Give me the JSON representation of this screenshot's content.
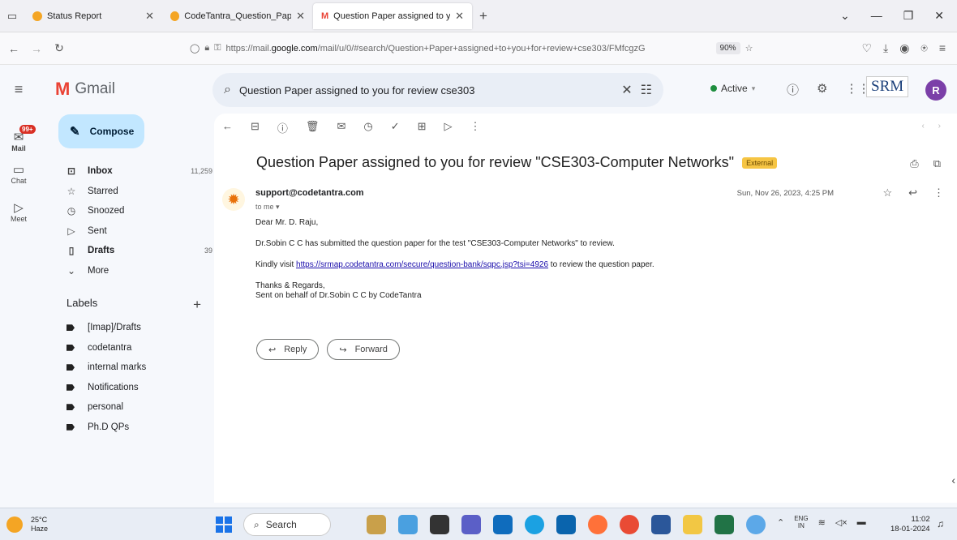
{
  "browser": {
    "tabs": [
      {
        "title": "Status Report",
        "active": false
      },
      {
        "title": "CodeTantra_Question_Paper_C",
        "active": false
      },
      {
        "title": "Question Paper assigned to you",
        "active": true
      }
    ],
    "url_prefix": "https://mail.",
    "url_domain": "google.com",
    "url_rest": "/mail/u/0/#search/Question+Paper+assigned+to+you+for+review+cse303/FMfcgzG",
    "zoom": "90%"
  },
  "gmail": {
    "app_name": "Gmail",
    "search_query": "Question Paper assigned to you for review cse303",
    "status": "Active",
    "org_logo_text": "SRM",
    "avatar_letter": "R",
    "rail": {
      "mail_label": "Mail",
      "mail_badge": "99+",
      "chat_label": "Chat",
      "meet_label": "Meet"
    },
    "compose_label": "Compose",
    "nav": [
      {
        "label": "Inbox",
        "count": "11,259",
        "bold": true
      },
      {
        "label": "Starred",
        "count": ""
      },
      {
        "label": "Snoozed",
        "count": ""
      },
      {
        "label": "Sent",
        "count": ""
      },
      {
        "label": "Drafts",
        "count": "39",
        "bold": true
      },
      {
        "label": "More",
        "count": ""
      }
    ],
    "labels_heading": "Labels",
    "labels": [
      "[Imap]/Drafts",
      "codetantra",
      "internal marks",
      "Notifications",
      "personal",
      "Ph.D QPs"
    ]
  },
  "email": {
    "subject": "Question Paper assigned to you for review \"CSE303-Computer Networks\"",
    "external_badge": "External",
    "sender": "support@codetantra.com",
    "to": "to me",
    "date": "Sun, Nov 26, 2023, 4:25 PM",
    "greeting": "Dear Mr. D. Raju,",
    "line1": "Dr.Sobin C C has submitted the question paper for the test \"CSE303-Computer Networks\" to review.",
    "line2_prefix": "Kindly visit ",
    "link": "https://srmap.codetantra.com/secure/question-bank/sqpc.jsp?tsi=4926",
    "line2_suffix": " to review the question paper.",
    "closing": "Thanks & Regards,",
    "signature": "Sent on behalf of Dr.Sobin C C by CodeTantra",
    "reply_label": "Reply",
    "forward_label": "Forward"
  },
  "taskbar": {
    "temperature": "25°C",
    "weather": "Haze",
    "search_label": "Search",
    "lang_top": "ENG",
    "lang_bottom": "IN",
    "time": "11:02",
    "date": "18-01-2024"
  },
  "colors": {
    "compose_bg": "#c2e7ff",
    "external_badge": "#f6c544",
    "active_dot": "#1e8e3e",
    "avatar": "#7b3fa8",
    "link": "#1a0dab"
  }
}
